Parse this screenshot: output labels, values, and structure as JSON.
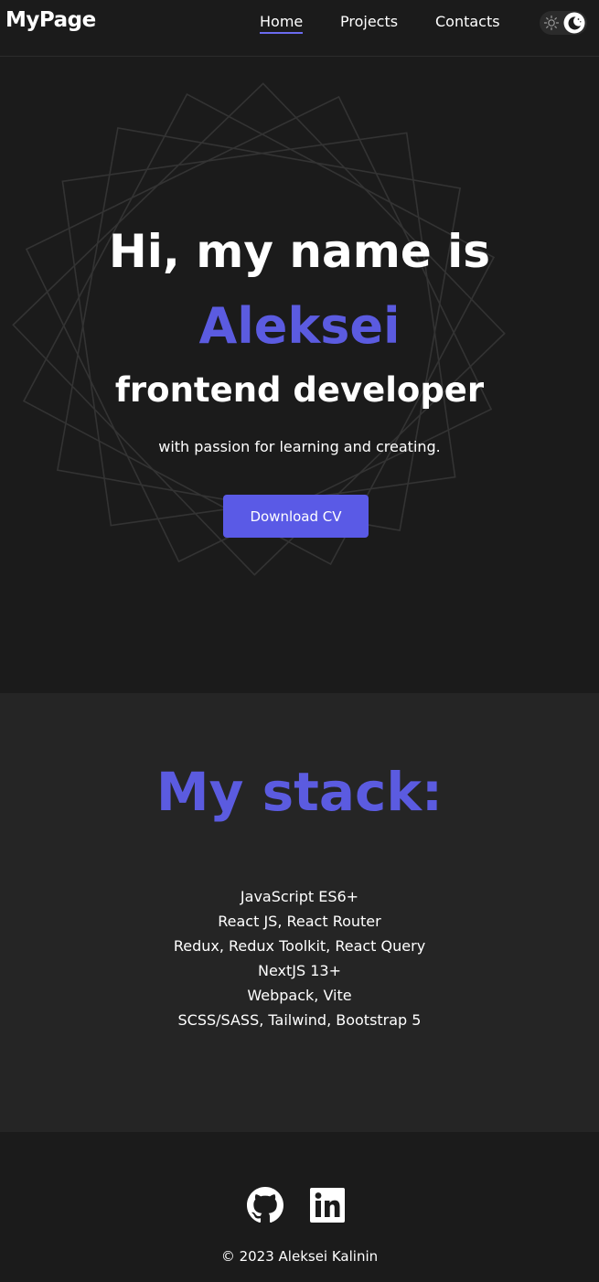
{
  "header": {
    "logo": "MyPage",
    "nav": [
      {
        "label": "Home",
        "active": true
      },
      {
        "label": "Projects",
        "active": false
      },
      {
        "label": "Contacts",
        "active": false
      }
    ],
    "theme_toggle": {
      "sun_icon": "sun-icon",
      "moon_icon": "moon-icon",
      "mode": "dark"
    }
  },
  "hero": {
    "line1": "Hi, my name is",
    "name": "Aleksei",
    "role": "frontend developer",
    "tagline": "with passion for learning and creating.",
    "cta_label": "Download CV"
  },
  "stack": {
    "title": "My stack:",
    "items": [
      "JavaScript ES6+",
      "React JS, React Router",
      "Redux, Redux Toolkit, React Query",
      "NextJS 13+",
      "Webpack, Vite",
      "SCSS/SASS, Tailwind, Bootstrap 5"
    ]
  },
  "footer": {
    "icons": [
      "github-icon",
      "linkedin-icon"
    ],
    "copyright": "© 2023 Aleksei Kalinin"
  },
  "colors": {
    "background": "#1b1b1b",
    "section_alt": "#252525",
    "accent": "#5b5be0",
    "text": "#ffffff"
  }
}
